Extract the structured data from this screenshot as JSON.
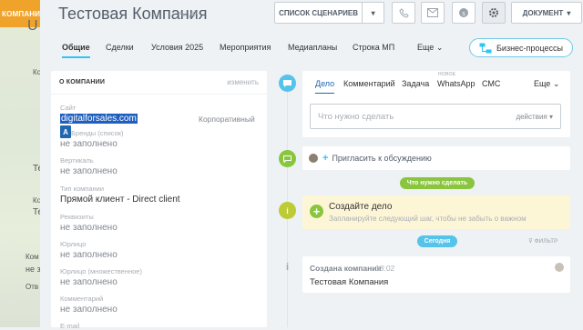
{
  "company_tag": "КОМПАНИЯ",
  "background_fragments": [
    "U",
    "Ко",
    "Те",
    "Ко",
    "Те",
    "Ком",
    "не з",
    "Отв"
  ],
  "header": {
    "title": "Тестовая Компания",
    "scenarios_label": "СПИСОК СЦЕНАРИЕВ",
    "document_label": "ДОКУМЕНТ"
  },
  "tabs": {
    "items": [
      "Общие",
      "Сделки",
      "Условия 2025",
      "Мероприятия",
      "Медиапланы",
      "Строка МП",
      "Еще"
    ],
    "business_processes": "Бизнес-процессы"
  },
  "card": {
    "heading": "О КОМПАНИИ",
    "edit": "изменить",
    "site_label": "Сайт",
    "site_value": "digitalforsales.com",
    "site_kind": "Корпоративный",
    "site_badge": "A",
    "fields": [
      {
        "label": "Бренды (список)",
        "value": "не заполнено"
      },
      {
        "label": "Вертикаль",
        "value": "не заполнено"
      },
      {
        "label": "Тип компании",
        "value": "Прямой клиент - Direct client"
      },
      {
        "label": "Реквизиты",
        "value": "не заполнено"
      },
      {
        "label": "Юрлицо",
        "value": "не заполнено"
      },
      {
        "label": "Юрлицо (множественное)",
        "value": "не заполнено"
      },
      {
        "label": "Комментарий",
        "value": "не заполнено"
      },
      {
        "label": "E-mail",
        "value": ""
      }
    ]
  },
  "editor": {
    "tabs": [
      "Дело",
      "Комментарий",
      "Задача",
      "WhatsApp",
      "СМС",
      "Еще"
    ],
    "new_badge": "НОВОЕ",
    "placeholder": "Что нужно сделать",
    "action": "действия"
  },
  "timeline": {
    "invite": "Пригласить к обсуждению",
    "todo_pill": "Что нужно сделать",
    "todo_title": "Создайте дело",
    "todo_hint": "Запланируйте следующий шаг, чтобы не забыть о важном",
    "today_pill": "Сегодня",
    "filter": "ФИЛЬТР",
    "created_title": "Создана компания",
    "created_time": "18:02",
    "created_value": "Тестовая Компания"
  },
  "colors": {
    "accent_blue": "#2fc6f6",
    "green": "#8ac53e",
    "orange_tag": "#f0a32a",
    "timeline_blue": "#55c3ea"
  }
}
